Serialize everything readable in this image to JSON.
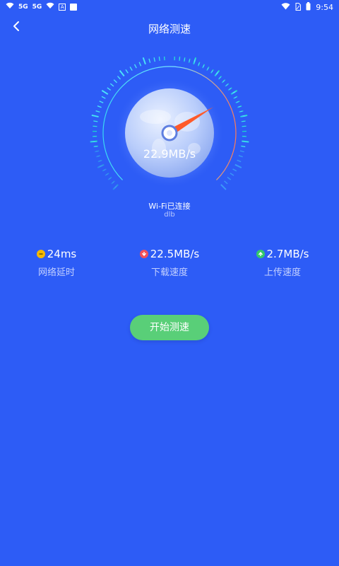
{
  "status_bar": {
    "network_left_1": "5G",
    "network_left_2": "5G",
    "badge": "A",
    "time": "9:54"
  },
  "header": {
    "title": "网络测速"
  },
  "gauge": {
    "speed_value": "22.9MB/s",
    "needle_fraction": 0.72
  },
  "wifi": {
    "status": "Wi-Fi已连接",
    "name": "dlb"
  },
  "stats": {
    "latency": {
      "value": "24ms",
      "label": "网络延时",
      "icon": "minus-icon",
      "color": "#f5b800"
    },
    "download": {
      "value": "22.5MB/s",
      "label": "下载速度",
      "icon": "arrow-down-icon",
      "color": "#f0505a"
    },
    "upload": {
      "value": "2.7MB/s",
      "label": "上传速度",
      "icon": "arrow-up-icon",
      "color": "#34c86a"
    }
  },
  "start_button": {
    "label": "开始测速"
  },
  "colors": {
    "background": "#2d5cf6",
    "button": "#59cf78",
    "needle": "#ff5a2a",
    "arc_start": "#3fd3e8",
    "arc_end": "#1fe0c0"
  }
}
